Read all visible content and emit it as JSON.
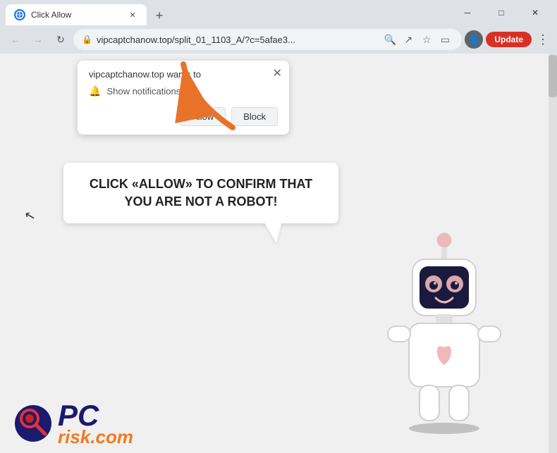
{
  "browser": {
    "tab": {
      "title": "Click Allow",
      "favicon": "🌐"
    },
    "new_tab_label": "+",
    "window_controls": {
      "minimize": "─",
      "maximize": "□",
      "close": "✕"
    },
    "address_bar": {
      "url": "vipcaptchanow.top/split_01_1103_A/?c=5afae3...",
      "lock": "🔒"
    },
    "update_btn": "Update"
  },
  "notification_popup": {
    "site": "vipcaptchanow.top wants to",
    "permission": "Show notifications",
    "allow_btn": "Allow",
    "block_btn": "Block",
    "close": "✕"
  },
  "speech_bubble": {
    "text": "CLICK «ALLOW» TO CONFIRM THAT YOU ARE NOT A ROBOT!"
  },
  "pcr_logo": {
    "text": "PC",
    "risk": "risk",
    "dot_com": ".com"
  },
  "colors": {
    "arrow_orange": "#e8722a",
    "update_red": "#d93025",
    "pcr_blue": "#1a1a6e",
    "pcr_orange": "#f47920"
  }
}
